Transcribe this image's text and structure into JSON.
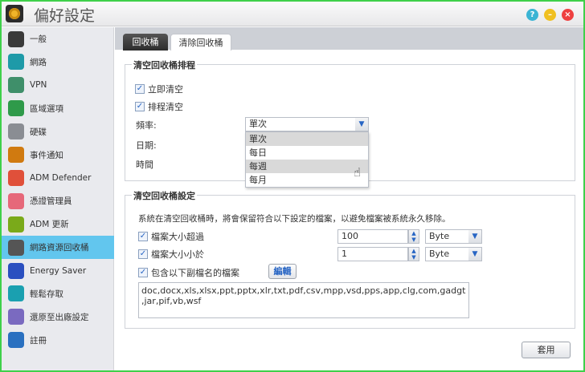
{
  "window": {
    "title": "偏好設定",
    "help": "?",
    "minimize": "–",
    "close": "×"
  },
  "sidebar": {
    "items": [
      {
        "label": "一般",
        "color": "#3a3a3a"
      },
      {
        "label": "網路",
        "color": "#1e9aa8"
      },
      {
        "label": "VPN",
        "color": "#3f8f6a"
      },
      {
        "label": "區域選項",
        "color": "#2f9a4a"
      },
      {
        "label": "硬碟",
        "color": "#8a8d93"
      },
      {
        "label": "事件通知",
        "color": "#d07a10"
      },
      {
        "label": "ADM Defender",
        "color": "#e0503a"
      },
      {
        "label": "憑證管理員",
        "color": "#e6687a"
      },
      {
        "label": "ADM 更新",
        "color": "#7aaa1a"
      },
      {
        "label": "網路資源回收桶",
        "color": "#555555"
      },
      {
        "label": "Energy Saver",
        "color": "#2a4fc0"
      },
      {
        "label": "輕鬆存取",
        "color": "#1aa0b0"
      },
      {
        "label": "還原至出廠設定",
        "color": "#7a6ac0"
      },
      {
        "label": "註冊",
        "color": "#2a70c0"
      }
    ],
    "selected": 9
  },
  "tabs": [
    {
      "label": "回收桶"
    },
    {
      "label": "清除回收桶"
    }
  ],
  "schedule": {
    "legend": "清空回收桶排程",
    "immediate": "立即清空",
    "scheduled": "排程清空",
    "freq_label": "頻率:",
    "date_label": "日期:",
    "time_label": "時間",
    "freq_value": "單次",
    "options": [
      "單次",
      "每日",
      "每週",
      "每月"
    ]
  },
  "settings": {
    "legend": "清空回收桶設定",
    "desc": "系統在清空回收桶時，將會保留符合以下設定的檔案，以避免檔案被系統永久移除。",
    "larger": "檔案大小超過",
    "larger_value": "100",
    "larger_unit": "Byte",
    "smaller": "檔案大小小於",
    "smaller_value": "1",
    "smaller_unit": "Byte",
    "ext": "包含以下副檔名的檔案",
    "edit": "編輯",
    "ext_list": "doc,docx,xls,xlsx,ppt,pptx,xlr,txt,pdf,csv,mpp,vsd,pps,app,clg,com,gadgt,jar,pif,vb,wsf"
  },
  "apply": "套用"
}
